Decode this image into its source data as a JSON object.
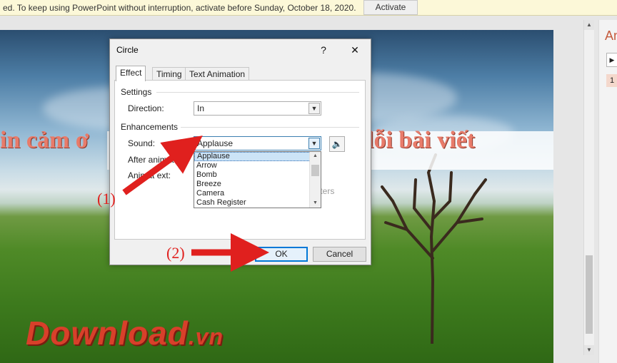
{
  "notification": {
    "text": "ed. To keep using PowerPoint without interruption, activate before Sunday, October 18, 2020.",
    "button": "Activate"
  },
  "slide": {
    "text_left": "in cảm ơ",
    "text_right": "lỗi bài viết",
    "watermark_main": "Download",
    "watermark_suffix": ".vn"
  },
  "right_pane": {
    "title": "An",
    "item_number": "1",
    "play_icon": "play-icon"
  },
  "dialog": {
    "title": "Circle",
    "help_button": "?",
    "close_button": "✕",
    "tabs": [
      {
        "label": "Effect",
        "active": true
      },
      {
        "label": "Timing",
        "active": false
      },
      {
        "label": "Text Animation",
        "active": false
      }
    ],
    "settings": {
      "group_label": "Settings",
      "direction_label": "Direction:",
      "direction_value": "In"
    },
    "enhancements": {
      "group_label": "Enhancements",
      "sound_label": "Sound:",
      "sound_value": "Applause",
      "after_animation_label": "After animat",
      "animate_text_label": "Animat",
      "animate_text_label_tail": "ext:",
      "letters_text": "tters",
      "speaker_icon": "speaker-icon"
    },
    "sound_options": [
      "Applause",
      "Arrow",
      "Bomb",
      "Breeze",
      "Camera",
      "Cash Register"
    ],
    "selected_sound": "Applause",
    "ok_label": "OK",
    "cancel_label": "Cancel"
  },
  "annotations": {
    "step1": "(1)",
    "step2": "(2)"
  },
  "colors": {
    "annotation_red": "#e0201e",
    "focus_blue": "#0078d7",
    "notification_bg": "#fcf8d8"
  }
}
